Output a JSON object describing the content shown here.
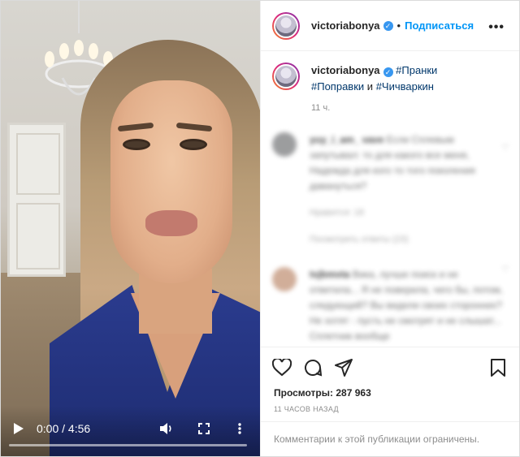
{
  "video": {
    "time_label": "0:00 / 4:56",
    "progress": 0.0
  },
  "header": {
    "username": "victoriabonya",
    "separator": "•",
    "follow_label": "Подписаться",
    "more_label": "•••"
  },
  "caption": {
    "username": "victoriabonya",
    "hashtag_1": "#Пранки",
    "hashtag_2": "#Поправки",
    "conjunction": "и",
    "hashtag_3": "#Чичваркин",
    "age": "11 ч."
  },
  "comments": [
    {
      "username": "yuy_i_am_ vave",
      "text": "Если Сплевым запутывал: то для какого все меня, Надежда для кого то того поколения давануться?",
      "meta_likes": "Нравится: 18",
      "meta_replies": "Посмотреть ответы (23)"
    },
    {
      "username": "tvjbmvta",
      "text": "Вика, лучше поиск и не ответила... Я не поверила, чего бы, потом, следующий? Вы видели своих сторонних? Не хотят - пусть не смотрят и не слышат... Сплетник вообще"
    }
  ],
  "stats": {
    "views_label": "Просмотры:",
    "views_count": "287 963",
    "posted_ago": "11 часов назад"
  },
  "footer": {
    "comments_limited": "Комментарии к этой публикации ограничены."
  },
  "colors": {
    "accent": "#0095f6",
    "verified": "#3897f0",
    "muted": "#8e8e8e"
  }
}
